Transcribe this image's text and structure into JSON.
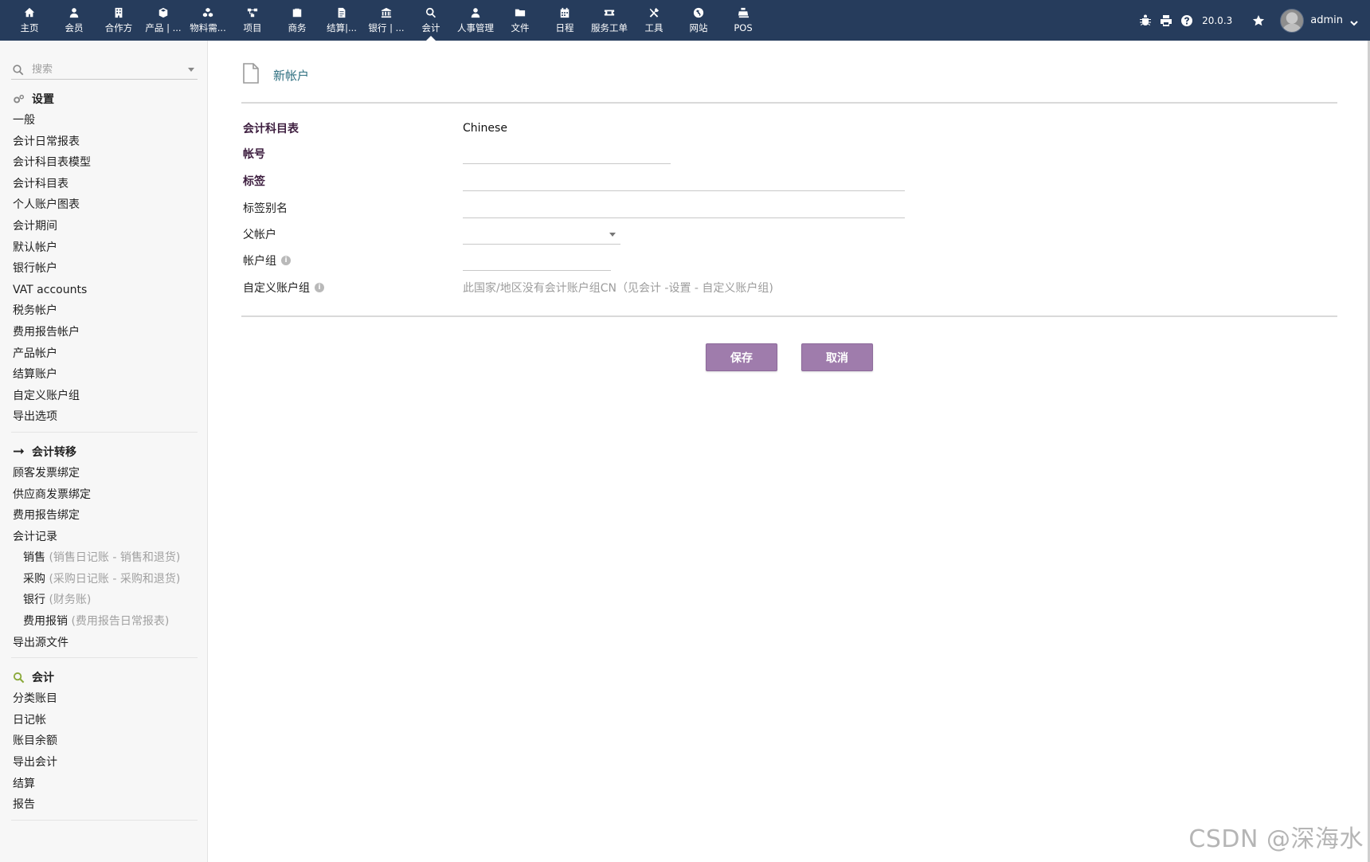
{
  "topnav": {
    "items": [
      {
        "label": "主页",
        "icon": "home-icon"
      },
      {
        "label": "会员",
        "icon": "user-icon"
      },
      {
        "label": "合作方",
        "icon": "building-icon"
      },
      {
        "label": "产品 | ...",
        "icon": "cube-icon"
      },
      {
        "label": "物料需...",
        "icon": "cubes-icon"
      },
      {
        "label": "项目",
        "icon": "sitemap-icon"
      },
      {
        "label": "商务",
        "icon": "briefcase-icon"
      },
      {
        "label": "结算|...",
        "icon": "invoice-icon"
      },
      {
        "label": "银行 | ...",
        "icon": "bank-icon"
      },
      {
        "label": "会计",
        "icon": "search-dollar-icon",
        "active": true
      },
      {
        "label": "人事管理",
        "icon": "user-tie-icon"
      },
      {
        "label": "文件",
        "icon": "folder-icon"
      },
      {
        "label": "日程",
        "icon": "calendar-icon"
      },
      {
        "label": "服务工单",
        "icon": "ticket-icon"
      },
      {
        "label": "工具",
        "icon": "tools-icon"
      },
      {
        "label": "网站",
        "icon": "globe-icon"
      },
      {
        "label": "POS",
        "icon": "cash-register-icon"
      }
    ],
    "version": "20.0.3",
    "username": "admin"
  },
  "sidebar": {
    "search_placeholder": "搜索",
    "sections": [
      {
        "title": "设置",
        "icon": "cogs-icon",
        "items": [
          "一般",
          "会计日常报表",
          "会计科目表模型",
          "会计科目表",
          "个人账户图表",
          "会计期间",
          "默认帐户",
          "银行帐户",
          "VAT accounts",
          "税务帐户",
          "费用报告帐户",
          "产品帐户",
          "结算账户",
          "自定义账户组",
          "导出选项"
        ]
      },
      {
        "title": "会计转移",
        "icon": "arrow-right-icon",
        "items": [
          "顾客发票绑定",
          "供应商发票绑定",
          "费用报告绑定",
          "会计记录"
        ],
        "subitems": [
          {
            "label": "销售",
            "note": "(销售日记账 - 销售和退货)"
          },
          {
            "label": "采购",
            "note": "(采购日记账 - 采购和退货)"
          },
          {
            "label": "银行",
            "note": "(财务账)"
          },
          {
            "label": "费用报销",
            "note": "(费用报告日常报表)"
          }
        ],
        "last_item": "导出源文件"
      },
      {
        "title": "会计",
        "icon": "search-dollar-icon",
        "items": [
          "分类账目",
          "日记帐",
          "账目余额",
          "导出会计",
          "结算",
          "报告"
        ]
      }
    ]
  },
  "main": {
    "title": "新帐户",
    "fields": {
      "chart_label": "会计科目表",
      "chart_value": "Chinese",
      "account_label": "帐号",
      "account_value": "",
      "tag_label": "标签",
      "tag_value": "",
      "alias_label": "标签别名",
      "alias_value": "",
      "parent_label": "父帐户",
      "group_label": "帐户组",
      "custom_group_label": "自定义账户组",
      "custom_group_hint": "此国家/地区没有会计账户组CN（见会计 -设置 - 自定义账户组)"
    },
    "buttons": {
      "save": "保存",
      "cancel": "取消"
    }
  },
  "watermark": "CSDN @深海水"
}
